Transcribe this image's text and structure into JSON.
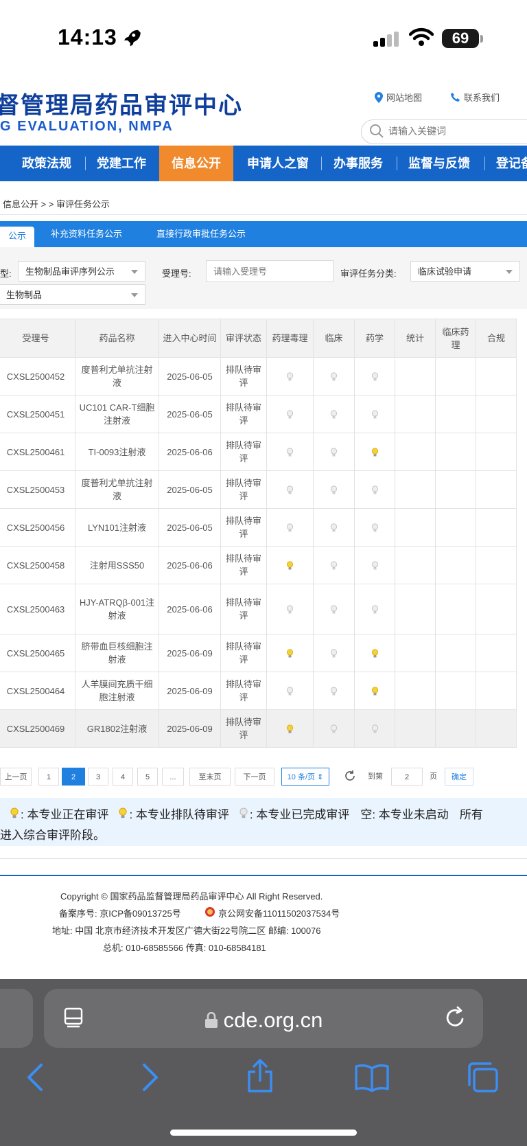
{
  "status": {
    "time": "14:13",
    "battery": "69"
  },
  "header": {
    "title": "督管理局药品审评中心",
    "subtitle": "G EVALUATION, NMPA",
    "sitemap": "网站地图",
    "contact": "联系我们",
    "search_placeholder": "请输入关键词"
  },
  "nav": {
    "items": [
      "政策法规",
      "党建工作",
      "信息公开",
      "申请人之窗",
      "办事服务",
      "监督与反馈",
      "登记备"
    ],
    "active": "信息公开"
  },
  "breadcrumb": "信息公开 > > 审评任务公示",
  "tabs": [
    "公示",
    "补充资料任务公示",
    "直接行政审批任务公示"
  ],
  "filter": {
    "label_type_suffix": "型:",
    "type_value": "生物制品审评序列公示",
    "label_accept": "受理号:",
    "accept_placeholder": "请输入受理号",
    "label_category": "审评任务分类:",
    "category_value": "临床试验申请",
    "product_value": "生物制品"
  },
  "table": {
    "headers": [
      "受理号",
      "药品名称",
      "进入中心时间",
      "审评状态",
      "药理毒理",
      "临床",
      "药学",
      "统计",
      "临床药理",
      "合规"
    ],
    "rows": [
      {
        "id": "CXSL2500452",
        "name": "度普利尤单抗注射液",
        "date": "2025-06-05",
        "status": "排队待审评",
        "pharm_tox": "done",
        "clinical": "done",
        "cmc": "done"
      },
      {
        "id": "CXSL2500451",
        "name": "UC101 CAR-T细胞注射液",
        "date": "2025-06-05",
        "status": "排队待审评",
        "pharm_tox": "done",
        "clinical": "done",
        "cmc": "done"
      },
      {
        "id": "CXSL2500461",
        "name": "TI-0093注射液",
        "date": "2025-06-06",
        "status": "排队待审评",
        "pharm_tox": "done",
        "clinical": "done",
        "cmc": "queued"
      },
      {
        "id": "CXSL2500453",
        "name": "度普利尤单抗注射液",
        "date": "2025-06-05",
        "status": "排队待审评",
        "pharm_tox": "done",
        "clinical": "done",
        "cmc": "done"
      },
      {
        "id": "CXSL2500456",
        "name": "LYN101注射液",
        "date": "2025-06-05",
        "status": "排队待审评",
        "pharm_tox": "done",
        "clinical": "done",
        "cmc": "done"
      },
      {
        "id": "CXSL2500458",
        "name": "注射用SSS50",
        "date": "2025-06-06",
        "status": "排队待审评",
        "pharm_tox": "queued",
        "clinical": "done",
        "cmc": "done"
      },
      {
        "id": "CXSL2500463",
        "name": "HJY-ATRQβ-001注射液",
        "date": "2025-06-06",
        "status": "排队待审评",
        "pharm_tox": "done",
        "clinical": "done",
        "cmc": "done"
      },
      {
        "id": "CXSL2500465",
        "name": "脐带血巨核细胞注射液",
        "date": "2025-06-09",
        "status": "排队待审评",
        "pharm_tox": "queued",
        "clinical": "done",
        "cmc": "queued"
      },
      {
        "id": "CXSL2500464",
        "name": "人羊膜间充质干细胞注射液",
        "date": "2025-06-09",
        "status": "排队待审评",
        "pharm_tox": "done",
        "clinical": "done",
        "cmc": "queued"
      },
      {
        "id": "CXSL2500469",
        "name": "GR1802注射液",
        "date": "2025-06-09",
        "status": "排队待审评",
        "pharm_tox": "queued",
        "clinical": "done",
        "cmc": "done"
      }
    ]
  },
  "pagination": {
    "prev": "上一页",
    "pages": [
      "1",
      "2",
      "3",
      "4",
      "5",
      "..."
    ],
    "current": "2",
    "last": "至末页",
    "next": "下一页",
    "page_size": "10 条/页",
    "goto_label": "到第",
    "goto_value": "2",
    "page_unit": "页",
    "confirm": "确定"
  },
  "legend": {
    "in_review": ": 本专业正在审评",
    "queued": ": 本专业排队待审评",
    "done": ": 本专业已完成审评",
    "empty": "空: 本专业未启动",
    "tail": "所有",
    "line2": "进入综合审评阶段。"
  },
  "footer": {
    "copyright": "Copyright © 国家药品监督管理局药品审评中心    All Right Reserved.",
    "icp": "备案序号: 京ICP备09013725号",
    "police": "京公网安备11011502037534号",
    "address": "地址: 中国 北京市经济技术开发区广德大街22号院二区      邮编: 100076",
    "phone": "总机: 010-68585566      传真: 010-68584181"
  },
  "browser": {
    "url": "cde.org.cn"
  },
  "colors": {
    "nav": "#1565c8",
    "nav_active": "#f08a2d",
    "tab_bar": "#1f80e0",
    "bulb_queued": "#f5d13b",
    "bulb_done": "#d0d0d0"
  }
}
